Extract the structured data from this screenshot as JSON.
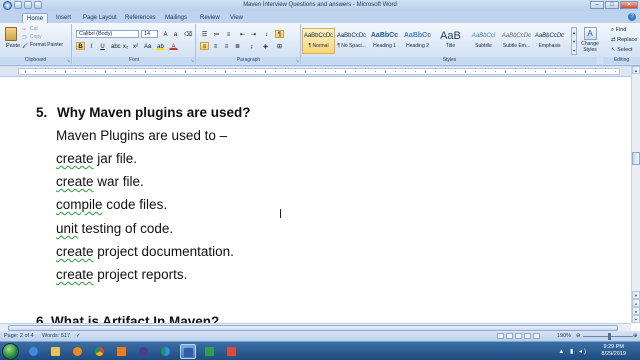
{
  "window": {
    "title": "Maven Interview Questions and answers - Microsoft Word",
    "controls": {
      "minimize": "–",
      "maximize": "□",
      "close": "✕"
    }
  },
  "ribbon_tabs": [
    {
      "label": "Home",
      "active": true
    },
    {
      "label": "Insert"
    },
    {
      "label": "Page Layout"
    },
    {
      "label": "References"
    },
    {
      "label": "Mailings"
    },
    {
      "label": "Review"
    },
    {
      "label": "View"
    }
  ],
  "help_icon": "?",
  "clipboard": {
    "paste_label": "Paste",
    "cut_label": "Cut",
    "copy_label": "Copy",
    "format_painter_label": "Format Painter",
    "group_label": "Clipboard"
  },
  "font": {
    "font_name": "Calibri (Body)",
    "font_size": "14",
    "bold": "B",
    "italic": "I",
    "underline": "U",
    "group_label": "Font",
    "font_color": "#c0392b",
    "highlight_color": "#f2e40c"
  },
  "paragraph": {
    "group_label": "Paragraph"
  },
  "styles": {
    "group_label": "Styles",
    "items": [
      {
        "sample": "AaBbCcDc",
        "name": "¶ Normal",
        "selected": true
      },
      {
        "sample": "AaBbCcDc",
        "name": "¶ No Spaci..."
      },
      {
        "sample": "AaBbCc",
        "name": "Heading 1"
      },
      {
        "sample": "AaBbCc",
        "name": "Heading 2"
      },
      {
        "sample": "AaB",
        "name": "Title"
      },
      {
        "sample": "AaBbCcl",
        "name": "Subtitle"
      },
      {
        "sample": "AaBbCcDc",
        "name": "Subtle Em..."
      },
      {
        "sample": "AaBbCcDc",
        "name": "Emphasis"
      }
    ],
    "change_styles_label": "Change Styles"
  },
  "editing": {
    "group_label": "Editing",
    "find_label": "Find",
    "replace_label": "Replace",
    "select_label": "Select"
  },
  "document": {
    "heading_number": "5.",
    "heading_text": "Why Maven plugins are used?",
    "intro": "Maven Plugins are used to –",
    "lines": [
      {
        "verb": "create",
        "rest": " jar file."
      },
      {
        "verb": "create",
        "rest": " war file."
      },
      {
        "verb": "compile",
        "rest": " code files."
      },
      {
        "verb": "unit",
        "rest": " testing of code."
      },
      {
        "verb": "create",
        "rest": " project documentation."
      },
      {
        "verb": "create",
        "rest": " project reports."
      }
    ],
    "next_heading": "6.  What is Artifact In Maven?"
  },
  "status_bar": {
    "page": "Page: 2 of 4",
    "words": "Words: 517",
    "zoom": "190%"
  },
  "taskbar": {
    "time": "9:29 PM",
    "date": "8/29/2019",
    "tray_icons": "▲ ▮ ◂)"
  }
}
